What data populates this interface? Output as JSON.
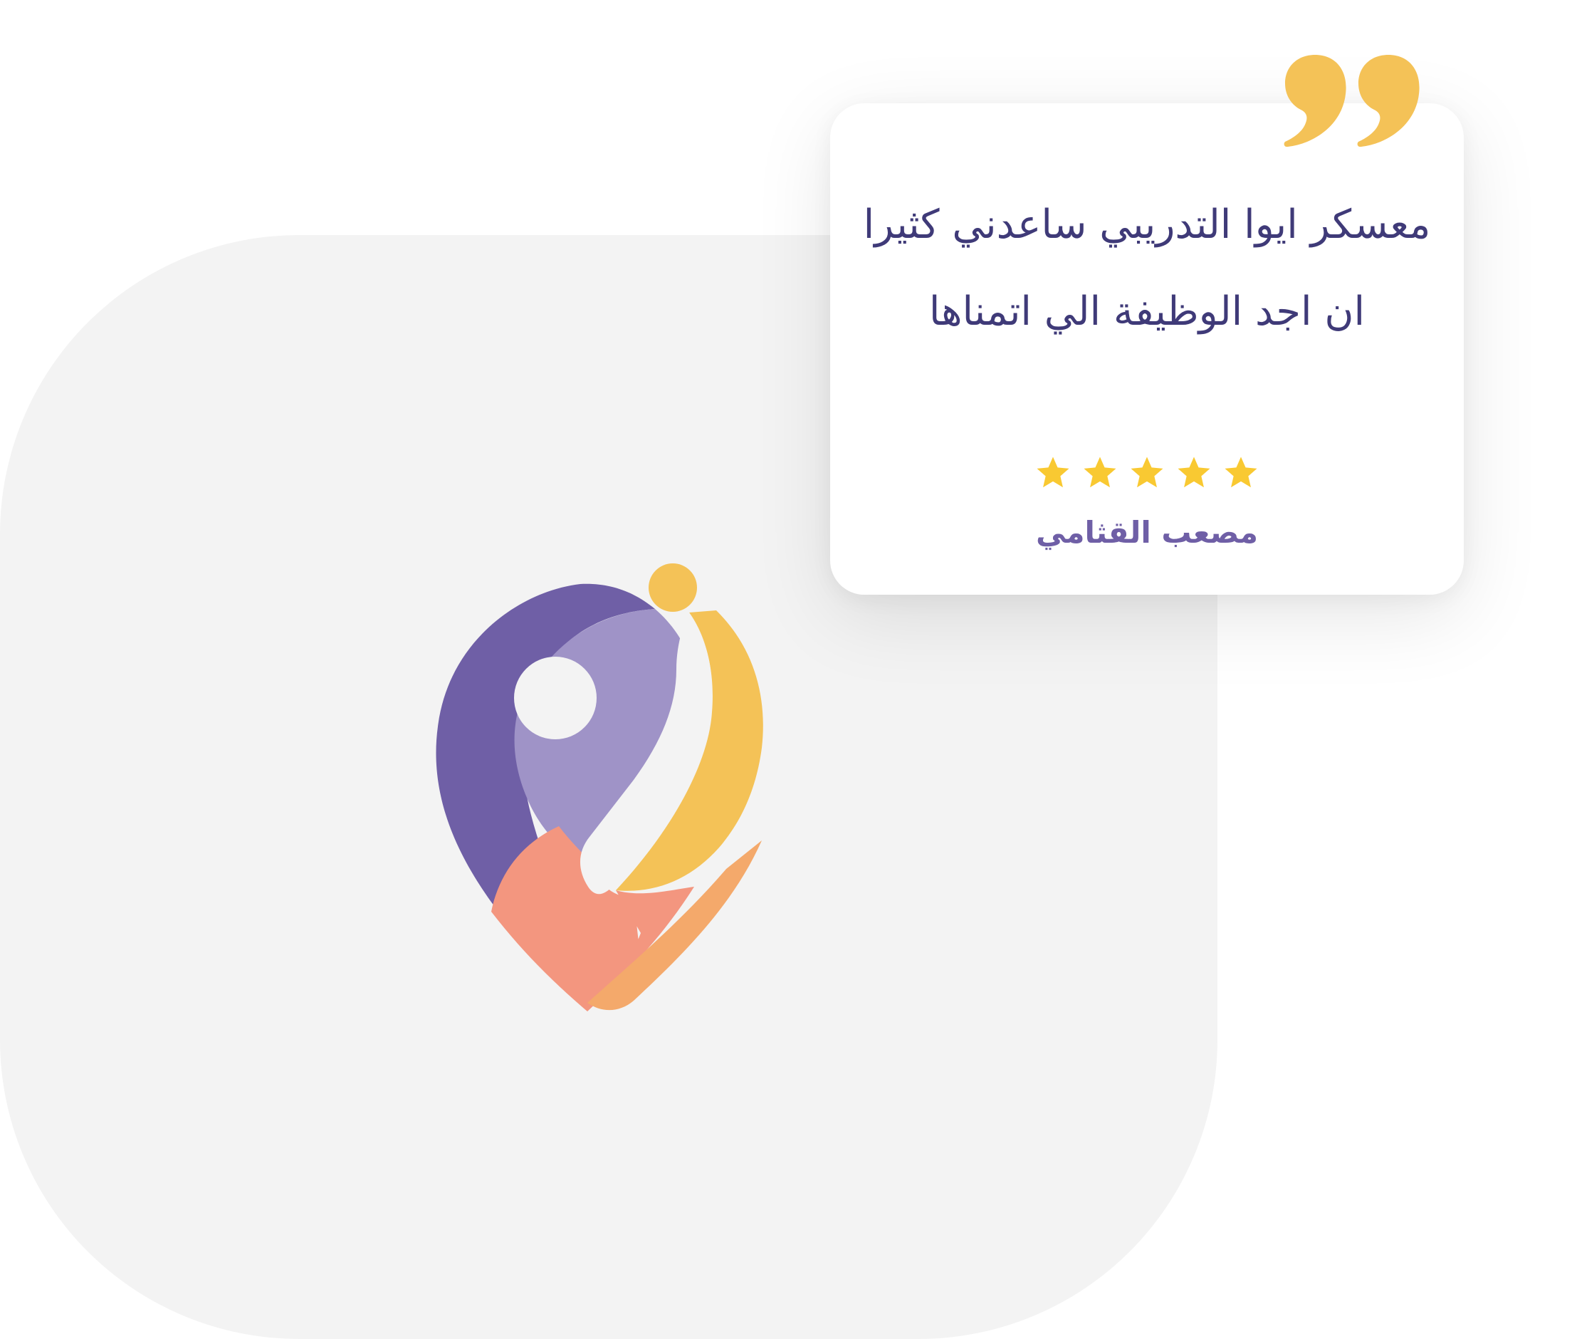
{
  "testimonial": {
    "quote": "معسكر ايوا التدريبي ساعدني كثيرا ان اجد الوظيفة الي اتمناها",
    "rating": 5,
    "rating_max": 5,
    "author": "مصعب القثامي"
  },
  "logo": {
    "name": "eiwa-logo",
    "colors": {
      "purple_dark": "#6f5fa6",
      "purple_light": "#9f93c7",
      "coral": "#f3967f",
      "orange": "#f4a96b",
      "yellow": "#f4c257"
    }
  },
  "colors": {
    "background": "#ffffff",
    "panel": "#f3f3f3",
    "card": "#ffffff",
    "quote_mark": "#f4c257",
    "star": "#f9c932",
    "quote_text": "#3f3a78",
    "author_text": "#6f5fa6"
  },
  "icons": {
    "quote": "quote-mark-icon",
    "star": "star-icon"
  }
}
